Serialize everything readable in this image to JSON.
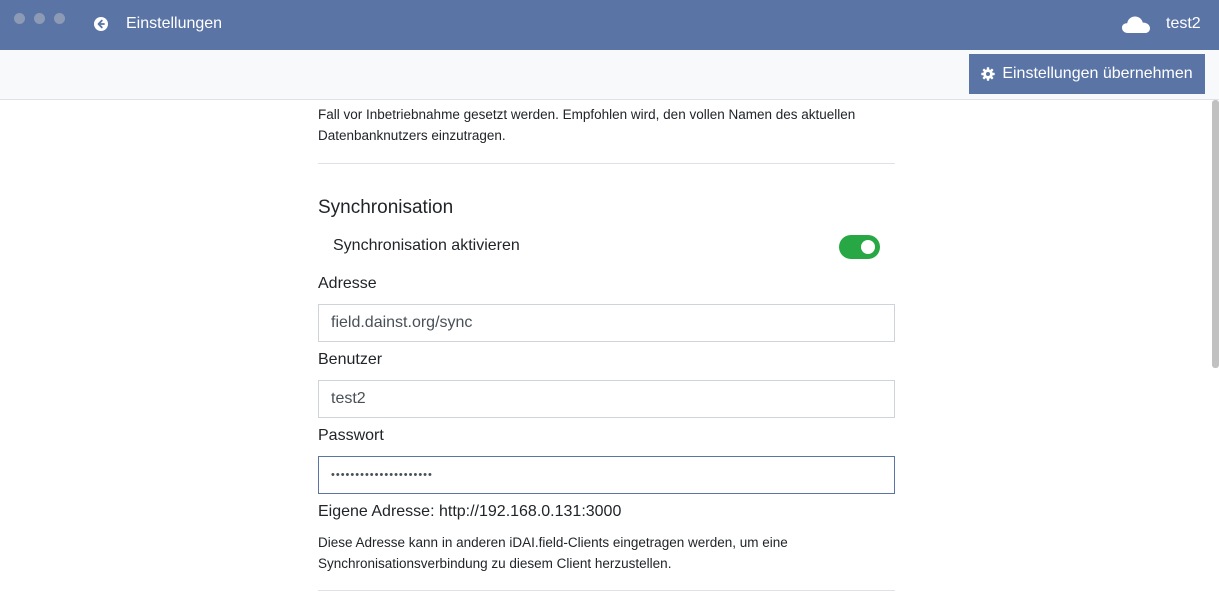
{
  "window": {
    "title": "Einstellungen",
    "user": "test2",
    "colors": {
      "titlebar": "#5a74a6",
      "toggle_on": "#28a745"
    }
  },
  "toolbar": {
    "apply_label": "Einstellungen übernehmen"
  },
  "info_top": {
    "lines": [
      "Fall vor Inbetriebnahme gesetzt werden. Empfohlen wird, den vollen Namen des aktuellen",
      "Datenbanknutzers einzutragen."
    ]
  },
  "sync": {
    "title": "Synchronisation",
    "toggle_label": "Synchronisation aktivieren",
    "enabled": true,
    "address_label": "Adresse",
    "address_value": "field.dainst.org/sync",
    "user_label": "Benutzer",
    "user_value": "test2",
    "password_label": "Passwort",
    "password_value": "•••••••••••••••••••••",
    "own_address": "Eigene Adresse: http://192.168.0.131:3000",
    "own_address_info": [
      "Diese Adresse kann in anderen iDAI.field-Clients eingetragen werden, um eine",
      "Synchronisationsverbindung zu diesem Client herzustellen."
    ]
  },
  "icons": [
    "back-arrow-icon",
    "cloud-icon",
    "gear-icon"
  ]
}
